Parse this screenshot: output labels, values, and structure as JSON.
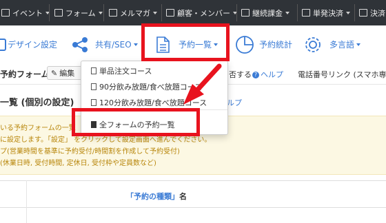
{
  "topnav": {
    "items": [
      {
        "label": "イベント",
        "icon": "calendar-icon"
      },
      {
        "label": "フォーム",
        "icon": "form-icon"
      },
      {
        "label": "メルマガ",
        "icon": "mail-icon"
      },
      {
        "label": "顧客・メンバー",
        "icon": "users-icon"
      },
      {
        "label": "継続課金",
        "icon": "card-icon"
      },
      {
        "label": "単発決済",
        "icon": "card-icon"
      },
      {
        "label": "決済",
        "icon": "card-icon"
      }
    ]
  },
  "toolbar": {
    "design": "デザイン設定",
    "share": "共有/SEO",
    "reservations": "予約一覧",
    "stats": "予約統計",
    "languages": "多言語"
  },
  "subbar": {
    "title": "予約フォーム",
    "edit": "編集",
    "right_text": "否する",
    "help": "ヘルプ",
    "phone_link": "電話番号リンク (スマホ専"
  },
  "section": {
    "title": "一覧 (個別の設定)",
    "help": "ヘルプ"
  },
  "notice": {
    "lines": [
      "いる予約フォームの一覧",
      "に設定します。「設定」 をクリックして設定画面へ進んでください。",
      "プ(営業時間を基準に予約受付/時間割を作成して予約受付)",
      "(休業日時, 受付時間, 定休日, 受付枠や定員数など)"
    ]
  },
  "table": {
    "header_link": "「予約の種類」",
    "header_suffix": "名"
  },
  "dropdown": {
    "items": [
      "単品注文コース",
      "90分飲み放題/食べ放題コース",
      "120分飲み放題/食べ放題コース"
    ],
    "all_label": "全フォームの予約一覧"
  },
  "colors": {
    "accent": "#3a7bd5",
    "highlight": "#e8131e",
    "nav_bg": "#2f3338"
  }
}
